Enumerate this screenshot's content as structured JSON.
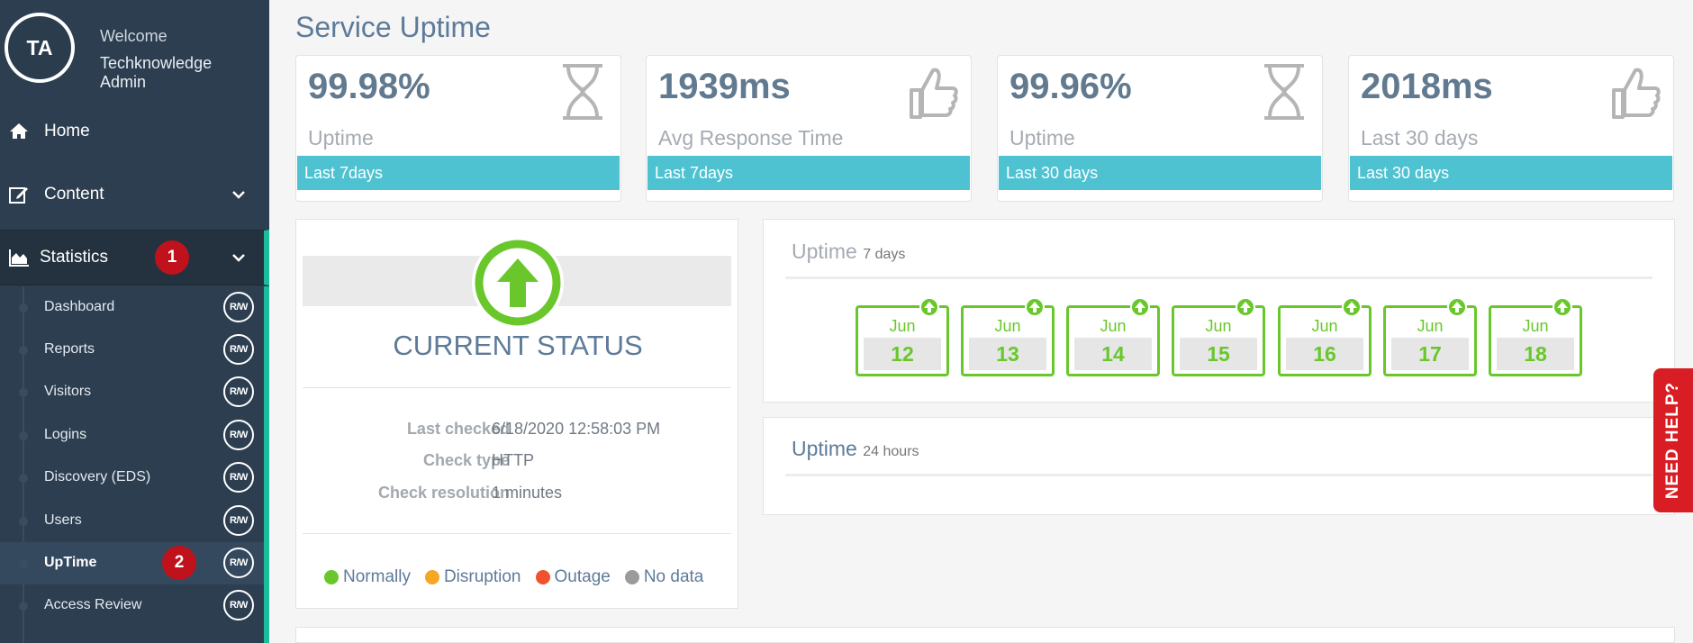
{
  "sidebar": {
    "avatar_initials": "TA",
    "welcome": "Welcome",
    "username": "Techknowledge Admin",
    "nav": {
      "home": "Home",
      "content": "Content",
      "statistics": "Statistics",
      "statistics_badge": "1"
    },
    "submenu": [
      {
        "label": "Dashboard",
        "rw": "R/W"
      },
      {
        "label": "Reports",
        "rw": "R/W"
      },
      {
        "label": "Visitors",
        "rw": "R/W"
      },
      {
        "label": "Logins",
        "rw": "R/W"
      },
      {
        "label": "Discovery (EDS)",
        "rw": "R/W"
      },
      {
        "label": "Users",
        "rw": "R/W"
      },
      {
        "label": "UpTime",
        "rw": "R/W",
        "badge": "2"
      },
      {
        "label": "Access Review",
        "rw": "R/W"
      }
    ]
  },
  "main": {
    "title": "Service Uptime",
    "cards": [
      {
        "value": "99.98%",
        "label": "Uptime",
        "period": "Last 7days",
        "icon": "hourglass-icon"
      },
      {
        "value": "1939ms",
        "label": "Avg Response Time",
        "period": "Last 7days",
        "icon": "thumbs-up-icon"
      },
      {
        "value": "99.96%",
        "label": "Uptime",
        "period": "Last 30 days",
        "icon": "hourglass-icon"
      },
      {
        "value": "2018ms",
        "label": "Last 30 days",
        "period": "Last 30 days",
        "icon": "thumbs-up-icon"
      }
    ],
    "status": {
      "heading": "CURRENT STATUS",
      "last_checked_label": "Last checked",
      "last_checked_value": "6/18/2020 12:58:03 PM",
      "check_type_label": "Check type",
      "check_type_value": "HTTP",
      "check_resolution_label": "Check resolution",
      "check_resolution_value": "1 minutes",
      "legend": [
        {
          "label": "Normally",
          "color": "#69c72c"
        },
        {
          "label": "Disruption",
          "color": "#f5a623"
        },
        {
          "label": "Outage",
          "color": "#f0522f"
        },
        {
          "label": "No data",
          "color": "#9b9b9b"
        }
      ]
    },
    "uptime7": {
      "title": "Uptime",
      "subtitle": "7 days",
      "days": [
        {
          "month": "Jun",
          "day": "12"
        },
        {
          "month": "Jun",
          "day": "13"
        },
        {
          "month": "Jun",
          "day": "14"
        },
        {
          "month": "Jun",
          "day": "15"
        },
        {
          "month": "Jun",
          "day": "16"
        },
        {
          "month": "Jun",
          "day": "17"
        },
        {
          "month": "Jun",
          "day": "18"
        }
      ]
    },
    "uptime24": {
      "title": "Uptime",
      "subtitle": "24 hours"
    },
    "need_help": "NEED HELP?"
  },
  "colors": {
    "sidebar_bg": "#2c3e50",
    "accent_teal": "#1abc9c",
    "card_bar": "#4fc2d1",
    "status_green": "#69c72c",
    "badge_red": "#c0121c",
    "help_red": "#d81e24"
  }
}
